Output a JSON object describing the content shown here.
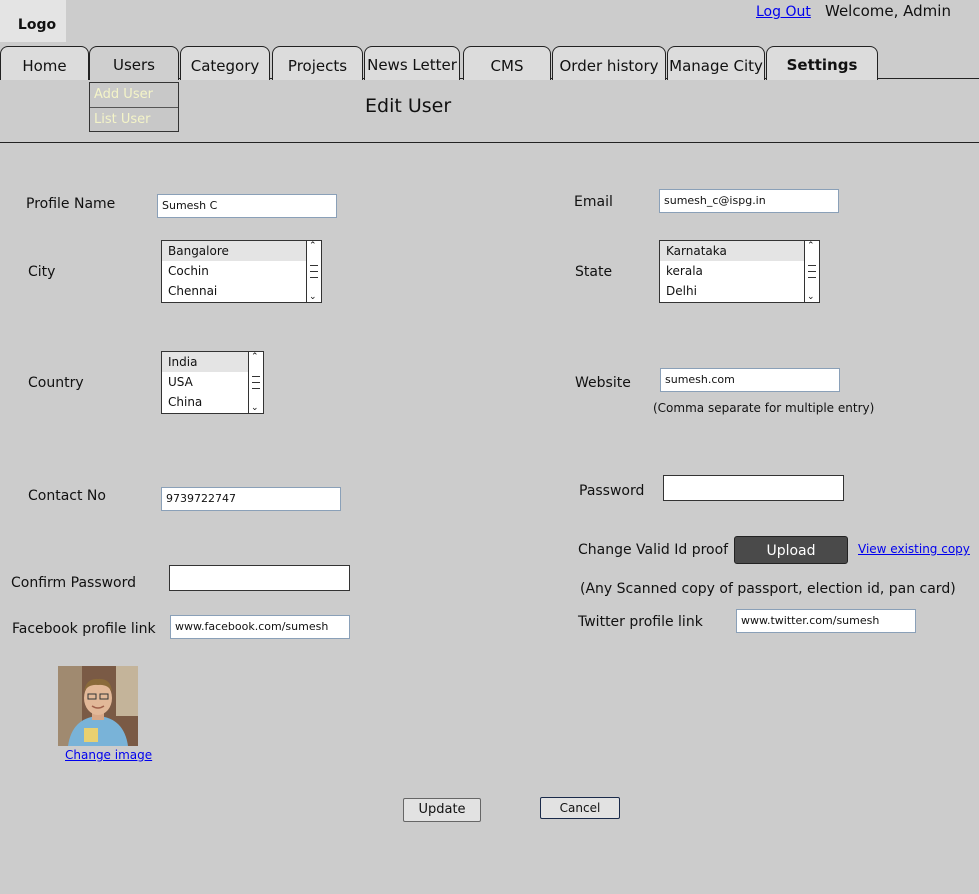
{
  "header": {
    "logo": "Logo",
    "logout": "Log Out",
    "welcome": "Welcome, Admin"
  },
  "nav": {
    "tabs": [
      "Home",
      "Users",
      "Category",
      "Projects",
      "News Letter",
      "CMS",
      "Order history",
      "Manage City",
      "Settings"
    ],
    "active": "Users",
    "users_menu": [
      "Add User",
      "List User"
    ]
  },
  "page": {
    "title": "Edit User"
  },
  "form": {
    "profile_name": {
      "label": "Profile Name",
      "value": "Sumesh C"
    },
    "email": {
      "label": "Email",
      "value": "sumesh_c@ispg.in"
    },
    "city": {
      "label": "City",
      "options": [
        "Bangalore",
        "Cochin",
        "Chennai"
      ],
      "selected": "Bangalore"
    },
    "state": {
      "label": "State",
      "options": [
        "Karnataka",
        "kerala",
        "Delhi"
      ],
      "selected": "Karnataka"
    },
    "country": {
      "label": "Country",
      "options": [
        "India",
        "USA",
        "China"
      ],
      "selected": "India"
    },
    "website": {
      "label": "Website",
      "value": "sumesh.com",
      "hint": "(Comma separate for multiple entry)"
    },
    "contact": {
      "label": "Contact No",
      "value": "9739722747"
    },
    "password": {
      "label": "Password",
      "value": ""
    },
    "id_proof": {
      "label": "Change Valid Id proof",
      "upload": "Upload",
      "view_link": "View existing copy",
      "hint": "(Any Scanned copy of passport, election id, pan card)"
    },
    "confirm_password": {
      "label": "Confirm Password",
      "value": ""
    },
    "facebook": {
      "label": "Facebook profile link",
      "value": "www.facebook.com/sumesh"
    },
    "twitter": {
      "label": "Twitter profile link",
      "value": "www.twitter.com/sumesh"
    },
    "photo": {
      "change_link": "Change image"
    }
  },
  "actions": {
    "update": "Update",
    "cancel": "Cancel"
  }
}
